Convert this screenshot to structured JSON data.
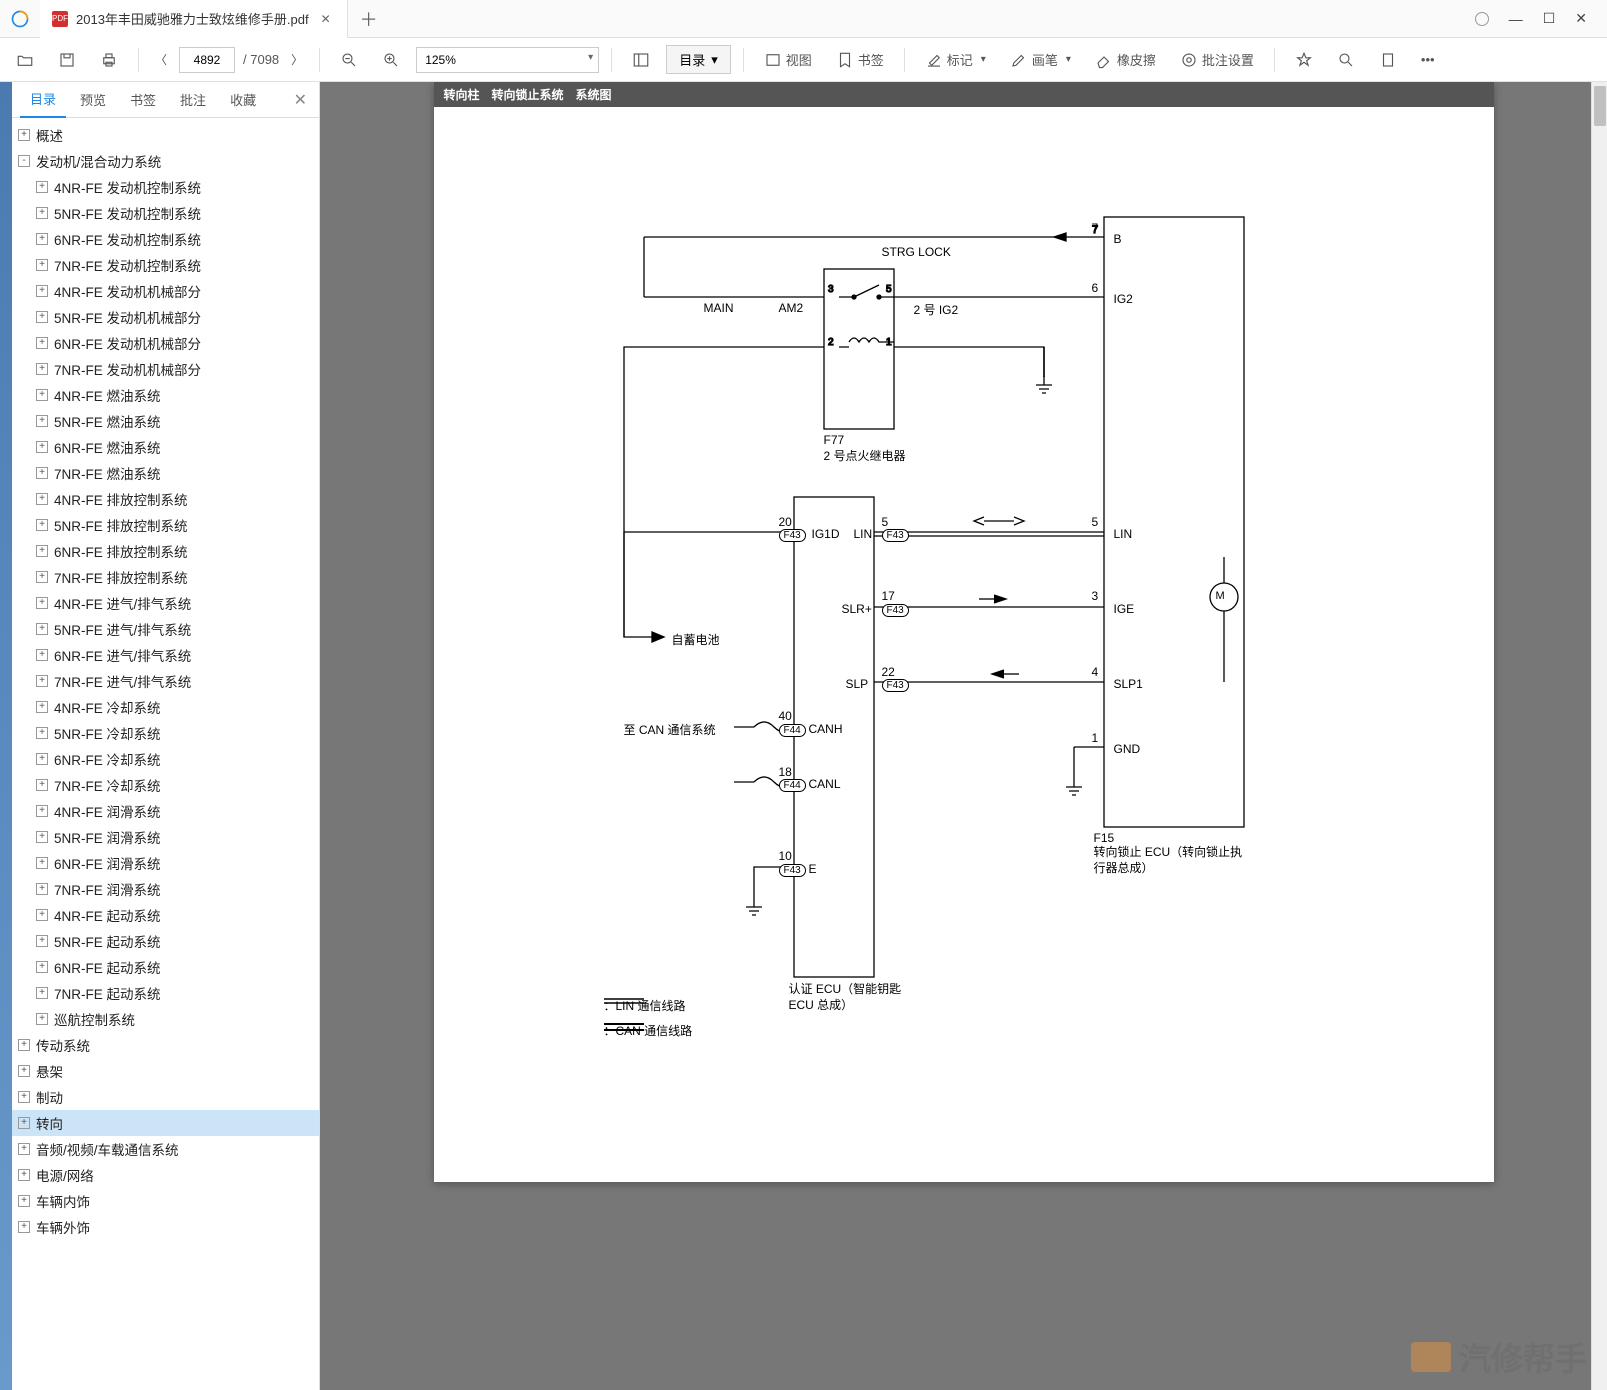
{
  "tab": {
    "title": "2013年丰田威驰雅力士致炫维修手册.pdf"
  },
  "toolbar": {
    "page_current": "4892",
    "page_total": "/ 7098",
    "zoom": "125%",
    "toc": "目录",
    "view": "视图",
    "bookmark": "书签",
    "mark": "标记",
    "pen": "画笔",
    "eraser": "橡皮擦",
    "batch": "批注设置"
  },
  "sidebar": {
    "tabs": {
      "toc": "目录",
      "preview": "预览",
      "bookmark": "书签",
      "annot": "批注",
      "favorite": "收藏"
    },
    "tree": [
      {
        "label": "概述",
        "level": 0,
        "expand": "+"
      },
      {
        "label": "发动机/混合动力系统",
        "level": 0,
        "expand": "-"
      },
      {
        "label": "4NR-FE 发动机控制系统",
        "level": 1,
        "expand": "+"
      },
      {
        "label": "5NR-FE 发动机控制系统",
        "level": 1,
        "expand": "+"
      },
      {
        "label": "6NR-FE 发动机控制系统",
        "level": 1,
        "expand": "+"
      },
      {
        "label": "7NR-FE 发动机控制系统",
        "level": 1,
        "expand": "+"
      },
      {
        "label": "4NR-FE 发动机机械部分",
        "level": 1,
        "expand": "+"
      },
      {
        "label": "5NR-FE 发动机机械部分",
        "level": 1,
        "expand": "+"
      },
      {
        "label": "6NR-FE 发动机机械部分",
        "level": 1,
        "expand": "+"
      },
      {
        "label": "7NR-FE 发动机机械部分",
        "level": 1,
        "expand": "+"
      },
      {
        "label": "4NR-FE 燃油系统",
        "level": 1,
        "expand": "+"
      },
      {
        "label": "5NR-FE 燃油系统",
        "level": 1,
        "expand": "+"
      },
      {
        "label": "6NR-FE 燃油系统",
        "level": 1,
        "expand": "+"
      },
      {
        "label": "7NR-FE 燃油系统",
        "level": 1,
        "expand": "+"
      },
      {
        "label": "4NR-FE 排放控制系统",
        "level": 1,
        "expand": "+"
      },
      {
        "label": "5NR-FE 排放控制系统",
        "level": 1,
        "expand": "+"
      },
      {
        "label": "6NR-FE 排放控制系统",
        "level": 1,
        "expand": "+"
      },
      {
        "label": "7NR-FE 排放控制系统",
        "level": 1,
        "expand": "+"
      },
      {
        "label": "4NR-FE 进气/排气系统",
        "level": 1,
        "expand": "+"
      },
      {
        "label": "5NR-FE 进气/排气系统",
        "level": 1,
        "expand": "+"
      },
      {
        "label": "6NR-FE 进气/排气系统",
        "level": 1,
        "expand": "+"
      },
      {
        "label": "7NR-FE 进气/排气系统",
        "level": 1,
        "expand": "+"
      },
      {
        "label": "4NR-FE 冷却系统",
        "level": 1,
        "expand": "+"
      },
      {
        "label": "5NR-FE 冷却系统",
        "level": 1,
        "expand": "+"
      },
      {
        "label": "6NR-FE 冷却系统",
        "level": 1,
        "expand": "+"
      },
      {
        "label": "7NR-FE 冷却系统",
        "level": 1,
        "expand": "+"
      },
      {
        "label": "4NR-FE 润滑系统",
        "level": 1,
        "expand": "+"
      },
      {
        "label": "5NR-FE 润滑系统",
        "level": 1,
        "expand": "+"
      },
      {
        "label": "6NR-FE 润滑系统",
        "level": 1,
        "expand": "+"
      },
      {
        "label": "7NR-FE 润滑系统",
        "level": 1,
        "expand": "+"
      },
      {
        "label": "4NR-FE 起动系统",
        "level": 1,
        "expand": "+"
      },
      {
        "label": "5NR-FE 起动系统",
        "level": 1,
        "expand": "+"
      },
      {
        "label": "6NR-FE 起动系统",
        "level": 1,
        "expand": "+"
      },
      {
        "label": "7NR-FE 起动系统",
        "level": 1,
        "expand": "+"
      },
      {
        "label": "巡航控制系统",
        "level": 1,
        "expand": "+"
      },
      {
        "label": "传动系统",
        "level": 0,
        "expand": "+"
      },
      {
        "label": "悬架",
        "level": 0,
        "expand": "+"
      },
      {
        "label": "制动",
        "level": 0,
        "expand": "+"
      },
      {
        "label": "转向",
        "level": 0,
        "expand": "+",
        "selected": true
      },
      {
        "label": "音频/视频/车载通信系统",
        "level": 0,
        "expand": "+"
      },
      {
        "label": "电源/网络",
        "level": 0,
        "expand": "+"
      },
      {
        "label": "车辆内饰",
        "level": 0,
        "expand": "+"
      },
      {
        "label": "车辆外饰",
        "level": 0,
        "expand": "+"
      }
    ]
  },
  "doc": {
    "header": "转向柱　转向锁止系统　系统图",
    "strg_lock": "STRG LOCK",
    "main": "MAIN",
    "am2": "AM2",
    "ig2_sw": "2 号 IG2",
    "f77": "F77",
    "f77_desc": "2 号点火继电器",
    "battery": "自蓄电池",
    "can_sys": "至 CAN 通信系统",
    "ig1d": "IG1D",
    "lin": "LIN",
    "slr": "SLR+",
    "slp": "SLP",
    "canh": "CANH",
    "canl": "CANL",
    "e": "E",
    "ecu_box": "认证 ECU（智能钥匙\nECU 总成）",
    "right_b": "B",
    "right_ig2": "IG2",
    "right_lin": "LIN",
    "right_ige": "IGE",
    "right_slp1": "SLP1",
    "right_gnd": "GND",
    "f15": "F15",
    "f15_desc": "转向锁止 ECU（转向锁止执\n行器总成）",
    "legend_lin": "：LIN 通信线路",
    "legend_can": "：CAN 通信线路",
    "pins": {
      "p7": "7",
      "p6": "6",
      "p3l": "3",
      "p5": "5",
      "p2": "2",
      "p1": "1",
      "p20": "20",
      "p5b": "5",
      "p5r": "5",
      "p17": "17",
      "p3r": "3",
      "p22": "22",
      "p4": "4",
      "p40": "40",
      "p18": "18",
      "p10": "10",
      "p1r": "1"
    },
    "conn": {
      "f43": "F43",
      "f44": "F44"
    }
  },
  "watermark": "汽修帮手"
}
